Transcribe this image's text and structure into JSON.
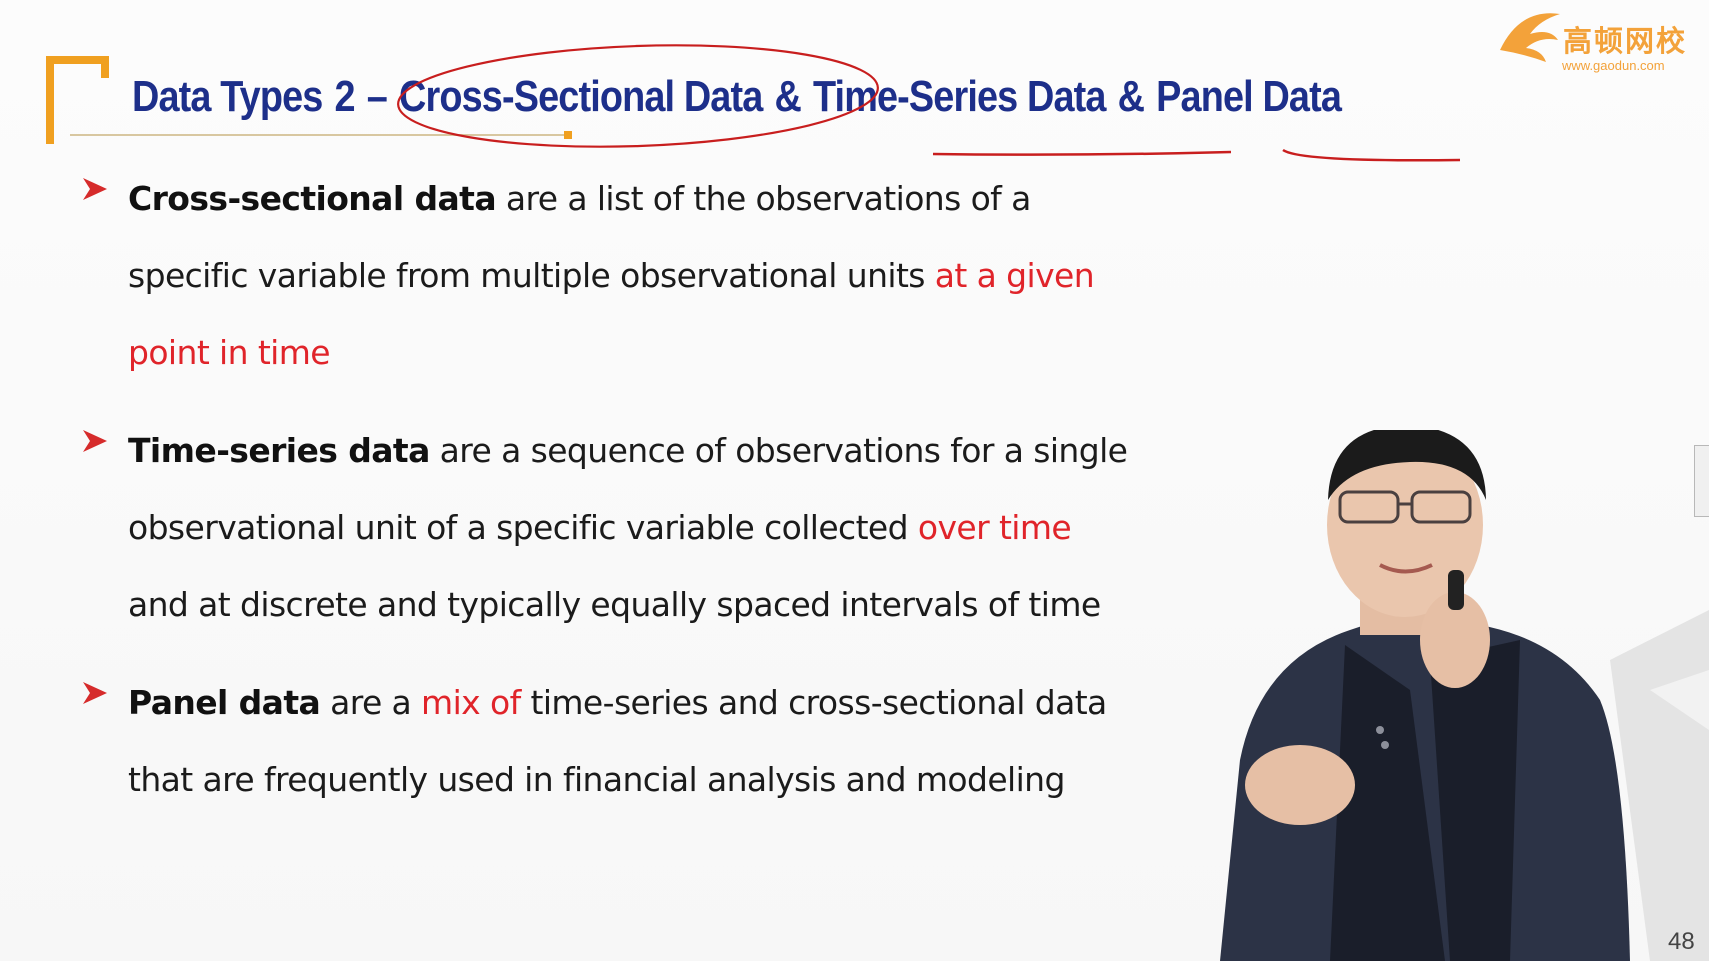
{
  "slide": {
    "title_parts": [
      "Data Types",
      "2",
      "–",
      "Cross-Sectional Data",
      "&",
      "Time-Series Data",
      "&",
      "Panel Data"
    ],
    "logo_text": "高顿网校",
    "logo_url": "www.gaodun.com",
    "page_number": "48"
  },
  "bullets": [
    {
      "lines": [
        [
          {
            "t": "Cross-sectional data",
            "s": "term"
          },
          {
            "t": " are a list of the observations of a",
            "s": ""
          }
        ],
        [
          {
            "t": "specific variable from multiple observational units ",
            "s": ""
          },
          {
            "t": "at a given",
            "s": "red"
          }
        ],
        [
          {
            "t": "point in time",
            "s": "red"
          }
        ]
      ]
    },
    {
      "lines": [
        [
          {
            "t": "Time-series data",
            "s": "term"
          },
          {
            "t": " are a sequence of observations for a single",
            "s": ""
          }
        ],
        [
          {
            "t": "observational unit of a specific variable collected ",
            "s": ""
          },
          {
            "t": "over time",
            "s": "red"
          }
        ],
        [
          {
            "t": "and at discrete and typically equally spaced intervals of time",
            "s": ""
          }
        ]
      ]
    },
    {
      "lines": [
        [
          {
            "t": "Panel data",
            "s": "term"
          },
          {
            "t": " are a ",
            "s": ""
          },
          {
            "t": "mix of",
            "s": "red"
          },
          {
            "t": " time-series and cross-sectional data",
            "s": ""
          }
        ],
        [
          {
            "t": "that are frequently used in financial analysis and modeling",
            "s": ""
          }
        ]
      ]
    }
  ],
  "colors": {
    "title_blue": "#1d2f8a",
    "accent_orange": "#f0a020",
    "highlight_red": "#e0242a",
    "annotation_red": "#c81e1e"
  },
  "icons": [
    "arrow-bullet-icon",
    "gaodun-logo-icon"
  ]
}
